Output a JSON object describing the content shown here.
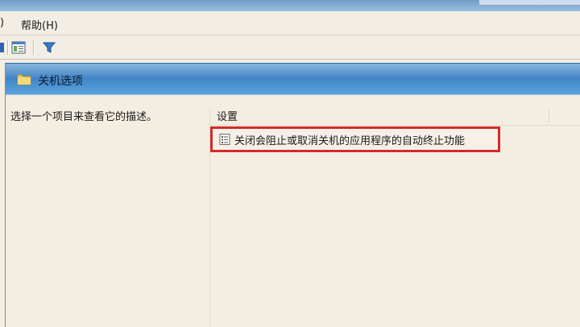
{
  "menu": {
    "partial_item": ")",
    "help": "帮助(H)"
  },
  "toolbar": {
    "icons": [
      "nav-icon",
      "show-hide-pane-icon",
      "filter-icon"
    ]
  },
  "header": {
    "title": "关机选项"
  },
  "description": {
    "text": "选择一个项目来查看它的描述。"
  },
  "list": {
    "column_header": "设置",
    "items": [
      {
        "label": "关闭会阻止或取消关机的应用程序的自动终止功能",
        "highlighted": true
      }
    ]
  },
  "colors": {
    "header_blue": "#3f83c6",
    "highlight_red": "#d32b2b",
    "pane_bg": "#f4ede2"
  }
}
